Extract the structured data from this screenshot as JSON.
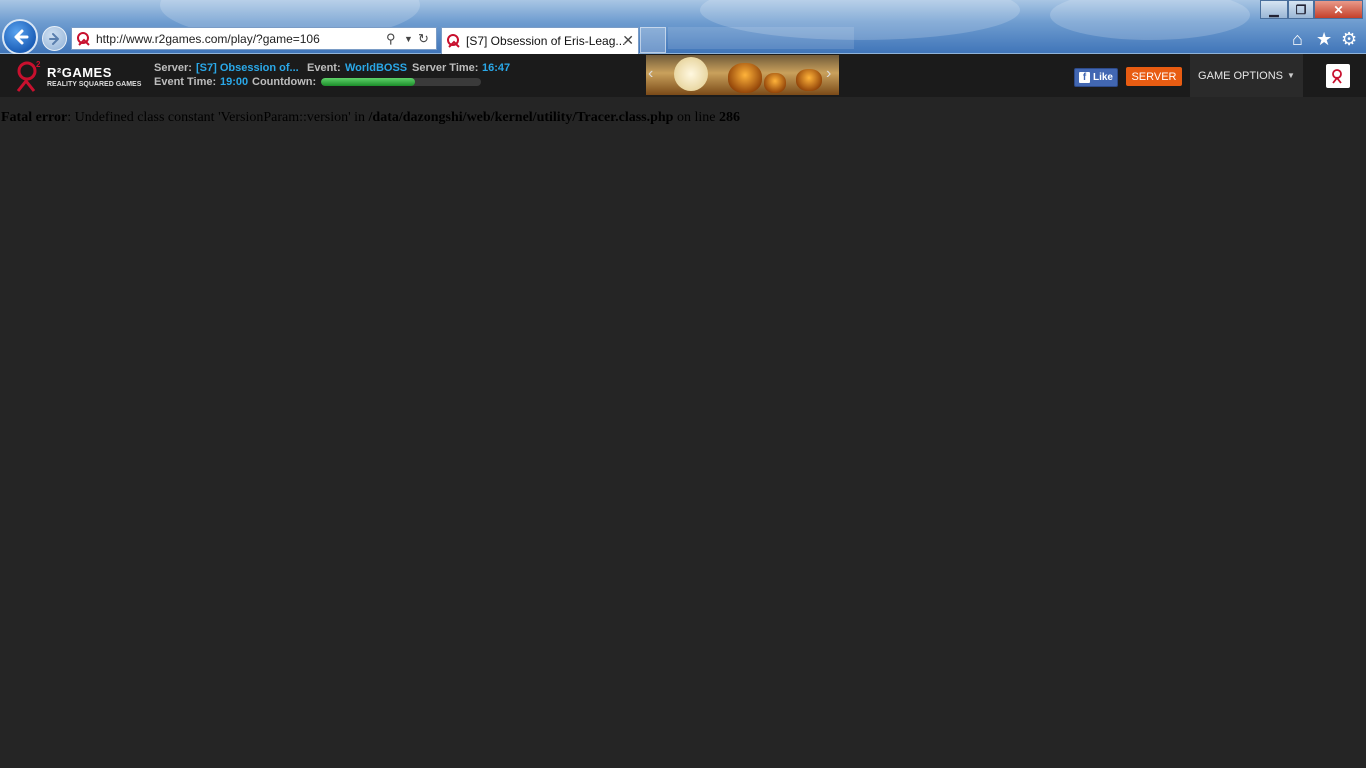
{
  "browser": {
    "url": "http://www.r2games.com/play/?game=106",
    "tab_title": "[S7] Obsession of Eris-Leag...",
    "ghost_tab": "",
    "window_buttons": {
      "minimize": "▁",
      "maximize": "❐",
      "close": "✕"
    },
    "icons": [
      "back-arrow-icon",
      "forward-arrow-icon",
      "search-icon",
      "refresh-icon",
      "home-icon",
      "favorites-star-icon",
      "settings-gear-icon"
    ]
  },
  "site": {
    "logo": {
      "name": "R²GAMES",
      "tagline": "REALITY SQUARED GAMES"
    },
    "server_label": "Server:",
    "server_value": "[S7] Obsession of...",
    "event_label": "Event:",
    "event_value": "WorldBOSS",
    "server_time_label": "Server Time:",
    "server_time_value": "16:47",
    "event_time_label": "Event Time:",
    "event_time_value": "19:00",
    "countdown_label": "Countdown:",
    "countdown_progress": 0.59,
    "fb_like": "Like",
    "server_button": "SERVER",
    "game_options": "GAME OPTIONS"
  },
  "error": {
    "prefix": "Fatal error",
    "message": ": Undefined class constant 'VersionParam::version' in ",
    "path": "/data/dazongshi/web/kernel/utility/Tracer.class.php",
    "line_text": " on line ",
    "line_number": "286"
  },
  "colors": {
    "page_bg": "#252525",
    "accent_blue": "#2aa8e8",
    "server_orange": "#e85c12",
    "facebook_blue": "#4267b2",
    "progress_green": "#1c8d2a"
  }
}
